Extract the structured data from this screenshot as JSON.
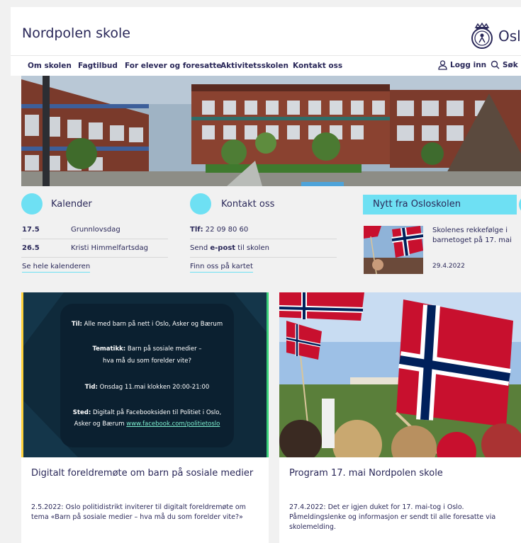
{
  "header": {
    "site_title": "Nordpolen skole",
    "logo_text": "Osl",
    "logo_icon": "oslo-seal-icon"
  },
  "nav": {
    "items": [
      "Om skolen",
      "Fagtilbud",
      "For elever og foresatte",
      "Aktivitetsskolen",
      "Kontakt oss"
    ],
    "login": "Logg inn",
    "search": "Søk"
  },
  "kalender": {
    "title": "Kalender",
    "events": [
      {
        "date": "17.5",
        "name": "Grunnlovsdag"
      },
      {
        "date": "26.5",
        "name": "Kristi Himmelfartsdag"
      }
    ],
    "link": "Se hele kalenderen"
  },
  "kontakt": {
    "title": "Kontakt oss",
    "tlf_label": "Tlf:",
    "tlf_value": "22 09 80 60",
    "send_pre": "Send",
    "send_bold": "e-post",
    "send_post": "til skolen",
    "link": "Finn oss på kartet"
  },
  "nytt": {
    "title": "Nytt fra Osloskolen",
    "item_title": "Skolenes rekkefølge i barnetoget på 17. mai",
    "item_date": "29.4.2022"
  },
  "cards": [
    {
      "title": "Digitalt foreldremøte om barn på sosiale medier",
      "text": "2.5.2022: Oslo politidistrikt inviterer til digitalt foreldremøte om tema «Barn på sosiale medier – hva må du som forelder vite?»",
      "poster": {
        "til_label": "Til:",
        "til_text": "Alle med barn på nett i Oslo, Asker og Bærum",
        "tema_label": "Tematikk:",
        "tema_text1": "Barn på sosiale medier –",
        "tema_text2": "hva må du som forelder vite?",
        "tid_label": "Tid:",
        "tid_text": "Onsdag 11.mai klokken 20:00-21:00",
        "sted_label": "Sted:",
        "sted_text1": "Digitalt på Facebooksiden til Politiet i Oslo,",
        "sted_text2": "Asker og Bærum",
        "sted_link": "www.facebook.com/politietoslo"
      }
    },
    {
      "title": "Program 17. mai Nordpolen skole",
      "text": "27.4.2022: Det er igjen duket for 17. mai-tog i Oslo. Påmeldingslenke og informasjon er sendt til alle foresatte via skolemelding."
    }
  ],
  "colors": {
    "navy": "#2a2859",
    "accent": "#6ee0f3",
    "background": "#f1f1f1"
  }
}
